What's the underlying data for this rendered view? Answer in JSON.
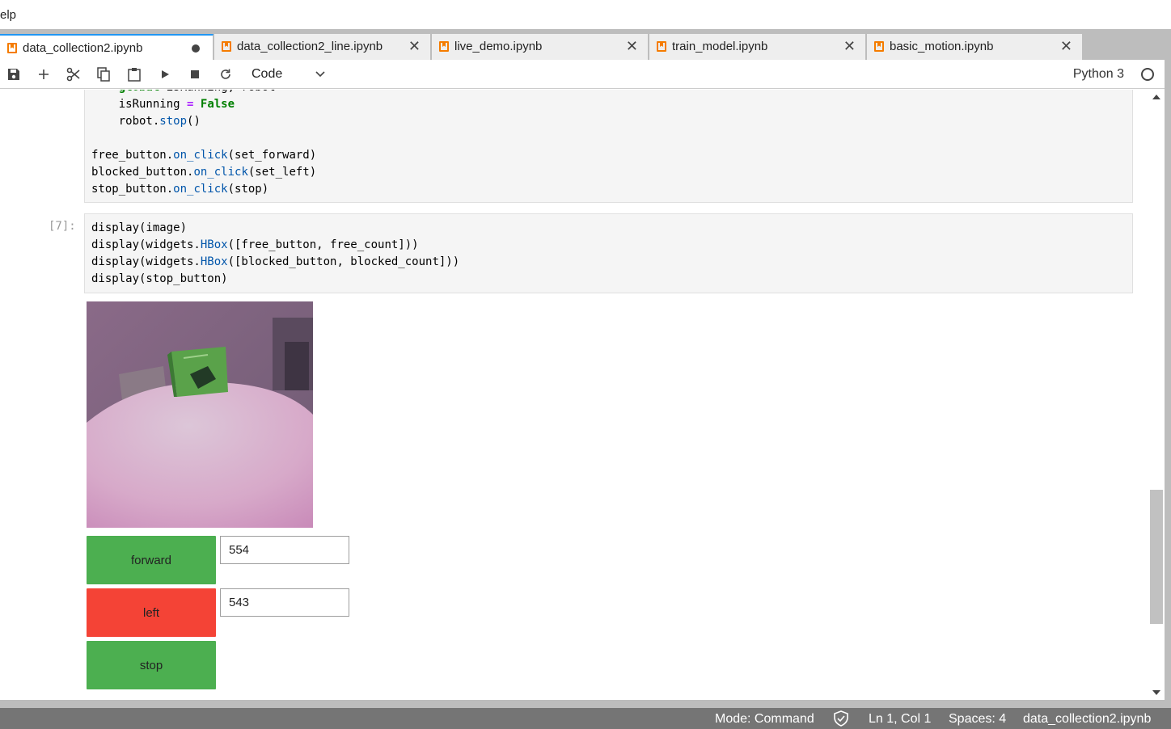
{
  "menubar": {
    "partial_menu": "elp"
  },
  "tabs": [
    {
      "label": "data_collection2.ipynb",
      "active": true,
      "modified": true
    },
    {
      "label": "data_collection2_line.ipynb",
      "active": false
    },
    {
      "label": "live_demo.ipynb",
      "active": false
    },
    {
      "label": "train_model.ipynb",
      "active": false
    },
    {
      "label": "basic_motion.ipynb",
      "active": false
    }
  ],
  "toolbar": {
    "icons": [
      "save-icon",
      "add-icon",
      "cut-icon",
      "copy-icon",
      "paste-icon",
      "run-icon",
      "stop-icon",
      "restart-icon"
    ],
    "cell_type": "Code",
    "kernel": "Python 3"
  },
  "cells": [
    {
      "prompt": "",
      "code_lines": [
        "    global isRunning, robot",
        "    isRunning = False",
        "    robot.stop()",
        "",
        "free_button.on_click(set_forward)",
        "blocked_button.on_click(set_left)",
        "stop_button.on_click(stop)"
      ]
    },
    {
      "prompt": "[7]:",
      "code_lines": [
        "display(image)",
        "display(widgets.HBox([free_button, free_count]))",
        "display(widgets.HBox([blocked_button, blocked_count]))",
        "display(stop_button)"
      ]
    }
  ],
  "output": {
    "buttons": [
      {
        "label": "forward",
        "color": "#4caf50",
        "count": "554"
      },
      {
        "label": "left",
        "color": "#f44336",
        "count": "543"
      },
      {
        "label": "stop",
        "color": "#4caf50"
      }
    ]
  },
  "statusbar": {
    "mode": "Mode: Command",
    "position": "Ln 1, Col 1",
    "spaces": "Spaces: 4",
    "filename": "data_collection2.ipynb"
  },
  "colors": {
    "accent": "#2196f3",
    "notebook_icon": "#f57c00",
    "green_button": "#4caf50",
    "red_button": "#f44336"
  }
}
